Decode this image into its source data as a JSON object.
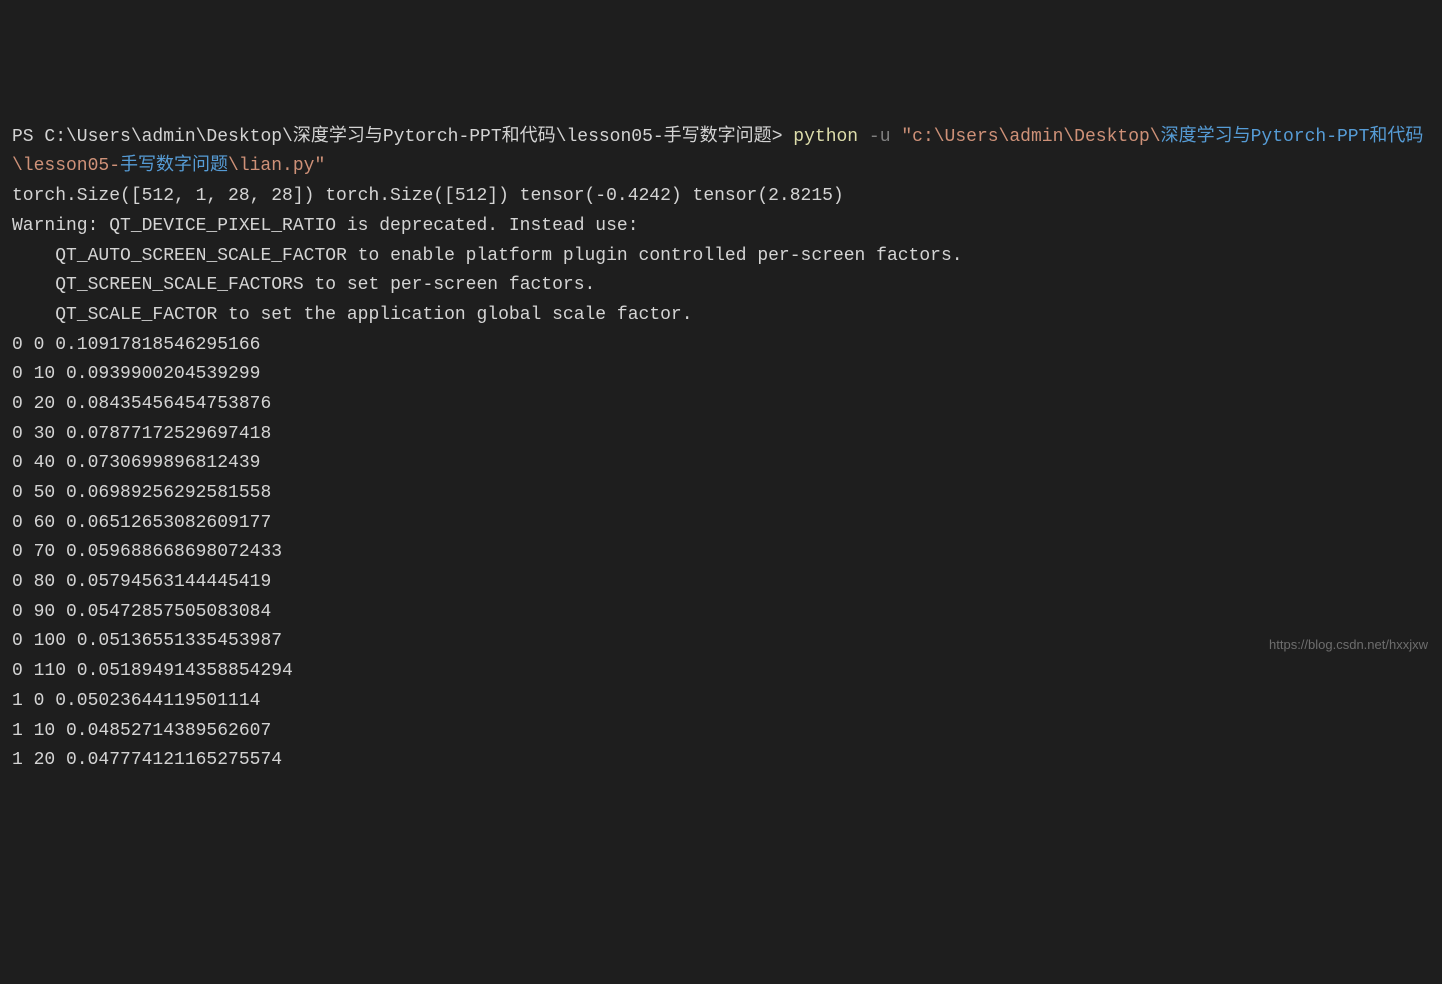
{
  "prompt": {
    "ps_prefix": "PS ",
    "cwd": "C:\\Users\\admin\\Desktop\\深度学习与Pytorch-PPT和代码\\lesson05-手写数字问题",
    "gt": "> ",
    "cmd_python": "python",
    "cmd_flag": " -u ",
    "cmd_path_q1": "\"",
    "cmd_path_seg1": "c:\\Users\\admin\\Deskt",
    "cmd_path_seg2": "op\\",
    "cmd_path_cjk1": "深度学习与Pytorch-PPT和代码",
    "cmd_path_seg3": "\\lesson05-",
    "cmd_path_cjk2": "手写数字问题",
    "cmd_path_seg4": "\\lian.py",
    "cmd_path_q2": "\""
  },
  "output": {
    "tensor_line": "torch.Size([512, 1, 28, 28]) torch.Size([512]) tensor(-0.4242) tensor(2.8215)",
    "warning_lines": [
      "Warning: QT_DEVICE_PIXEL_RATIO is deprecated. Instead use:",
      "    QT_AUTO_SCREEN_SCALE_FACTOR to enable platform plugin controlled per-screen factors.",
      "    QT_SCREEN_SCALE_FACTORS to set per-screen factors.",
      "    QT_SCALE_FACTOR to set the application global scale factor."
    ],
    "loss_lines": [
      "0 0 0.10917818546295166",
      "0 10 0.0939900204539299",
      "0 20 0.08435456454753876",
      "0 30 0.07877172529697418",
      "0 40 0.0730699896812439",
      "0 50 0.06989256292581558",
      "0 60 0.06512653082609177",
      "0 70 0.059688668698072433",
      "0 80 0.05794563144445419",
      "0 90 0.05472857505083084",
      "0 100 0.05136551335453987",
      "0 110 0.051894914358854294",
      "1 0 0.05023644119501114",
      "1 10 0.04852714389562607",
      "1 20 0.047774121165275574"
    ]
  },
  "watermark": "https://blog.csdn.net/hxxjxw"
}
